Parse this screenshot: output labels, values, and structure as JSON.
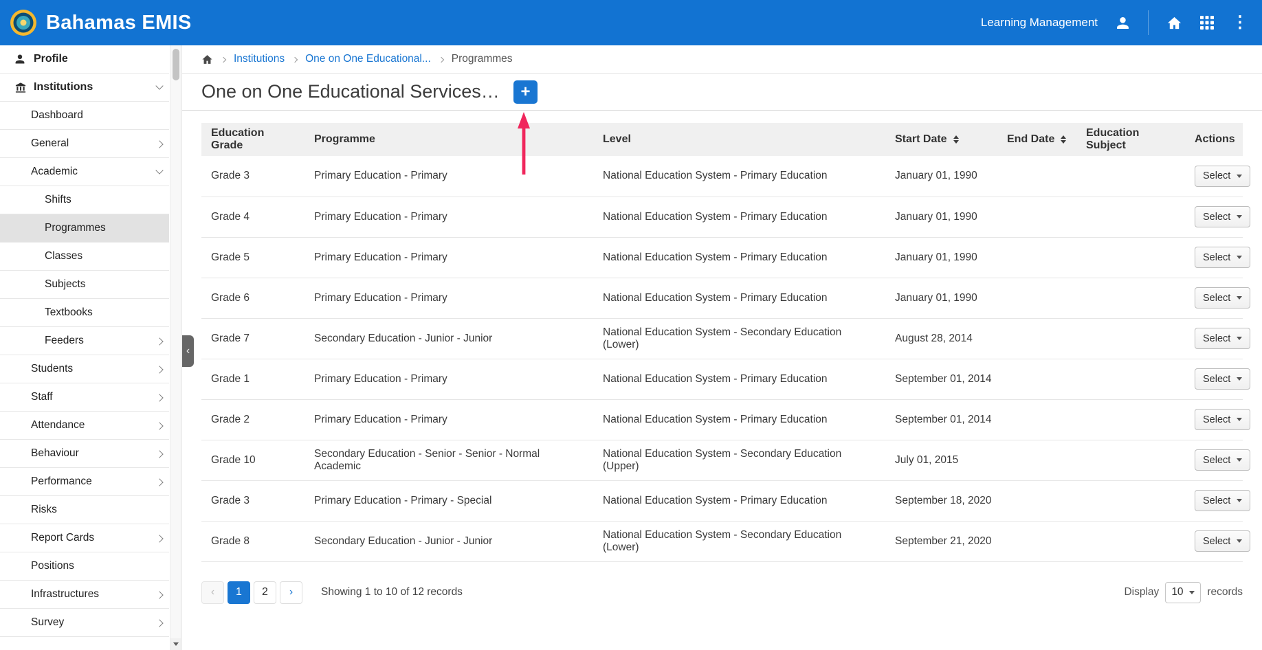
{
  "header": {
    "app_title": "Bahamas EMIS",
    "learning_management_label": "Learning Management",
    "more_icon_glyph": "⋮"
  },
  "sidebar": {
    "selected_item": "Programmes",
    "collapse_glyph": "‹",
    "items": [
      {
        "label": "Profile"
      },
      {
        "label": "Institutions"
      },
      {
        "label": "Dashboard"
      },
      {
        "label": "General"
      },
      {
        "label": "Academic"
      },
      {
        "label": "Shifts"
      },
      {
        "label": "Programmes"
      },
      {
        "label": "Classes"
      },
      {
        "label": "Subjects"
      },
      {
        "label": "Textbooks"
      },
      {
        "label": "Feeders"
      },
      {
        "label": "Students"
      },
      {
        "label": "Staff"
      },
      {
        "label": "Attendance"
      },
      {
        "label": "Behaviour"
      },
      {
        "label": "Performance"
      },
      {
        "label": "Risks"
      },
      {
        "label": "Report Cards"
      },
      {
        "label": "Positions"
      },
      {
        "label": "Infrastructures"
      },
      {
        "label": "Survey"
      }
    ]
  },
  "breadcrumb": {
    "items": [
      "Institutions",
      "One on One Educational...",
      "Programmes"
    ]
  },
  "page": {
    "title": "One on One Educational Services…",
    "add_button_glyph": "+"
  },
  "table": {
    "headers": {
      "education_grade": "Education Grade",
      "programme": "Programme",
      "level": "Level",
      "start_date": "Start Date",
      "end_date": "End Date",
      "education_subject": "Education Subject",
      "actions": "Actions"
    },
    "select_button_label": "Select",
    "rows": [
      {
        "education_grade": "Grade 3",
        "programme": "Primary Education - Primary",
        "level": "National Education System - Primary Education",
        "start_date": "January 01, 1990",
        "end_date": "",
        "education_subject": ""
      },
      {
        "education_grade": "Grade 4",
        "programme": "Primary Education - Primary",
        "level": "National Education System - Primary Education",
        "start_date": "January 01, 1990",
        "end_date": "",
        "education_subject": ""
      },
      {
        "education_grade": "Grade 5",
        "programme": "Primary Education - Primary",
        "level": "National Education System - Primary Education",
        "start_date": "January 01, 1990",
        "end_date": "",
        "education_subject": ""
      },
      {
        "education_grade": "Grade 6",
        "programme": "Primary Education - Primary",
        "level": "National Education System - Primary Education",
        "start_date": "January 01, 1990",
        "end_date": "",
        "education_subject": ""
      },
      {
        "education_grade": "Grade 7",
        "programme": "Secondary Education - Junior - Junior",
        "level": "National Education System - Secondary Education (Lower)",
        "start_date": "August 28, 2014",
        "end_date": "",
        "education_subject": ""
      },
      {
        "education_grade": "Grade 1",
        "programme": "Primary Education - Primary",
        "level": "National Education System - Primary Education",
        "start_date": "September 01, 2014",
        "end_date": "",
        "education_subject": ""
      },
      {
        "education_grade": "Grade 2",
        "programme": "Primary Education - Primary",
        "level": "National Education System - Primary Education",
        "start_date": "September 01, 2014",
        "end_date": "",
        "education_subject": ""
      },
      {
        "education_grade": "Grade 10",
        "programme": "Secondary Education - Senior - Senior - Normal Academic",
        "level": "National Education System - Secondary Education (Upper)",
        "start_date": "July 01, 2015",
        "end_date": "",
        "education_subject": ""
      },
      {
        "education_grade": "Grade 3",
        "programme": "Primary Education - Primary - Special",
        "level": "National Education System - Primary Education",
        "start_date": "September 18, 2020",
        "end_date": "",
        "education_subject": ""
      },
      {
        "education_grade": "Grade 8",
        "programme": "Secondary Education - Junior - Junior",
        "level": "National Education System - Secondary Education (Lower)",
        "start_date": "September 21, 2020",
        "end_date": "",
        "education_subject": ""
      }
    ]
  },
  "pagination": {
    "prev_glyph": "‹",
    "pages": [
      "1",
      "2"
    ],
    "active_page": "1",
    "next_glyph": "›",
    "showing_text": "Showing 1 to 10 of 12 records"
  },
  "display": {
    "label": "Display",
    "value": "10",
    "records_label": "records"
  },
  "colors": {
    "header_bg": "#1273d2",
    "accent_blue": "#1976d2",
    "annotation_arrow": "#f0265c",
    "selected_sidebar_bg": "#e2e2e2",
    "table_header_bg": "#f0f0f0"
  }
}
